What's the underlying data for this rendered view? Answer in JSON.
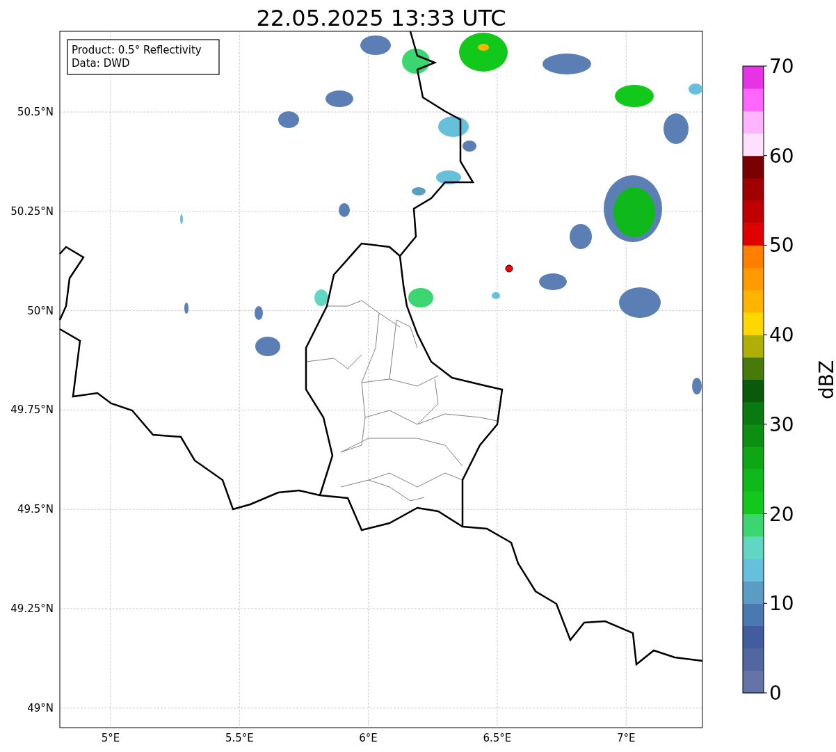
{
  "title": "22.05.2025 13:33 UTC",
  "info_box": {
    "lines": [
      "Product: 0.5° Reflectivity",
      "Data: DWD"
    ]
  },
  "map": {
    "lat_ticks": [
      "50.5°N",
      "50.25°N",
      "50°N",
      "49.75°N",
      "49.5°N",
      "49.25°N",
      "49°N"
    ],
    "lon_ticks": [
      "5°E",
      "5.5°E",
      "6°E",
      "6.5°E",
      "7°E"
    ]
  },
  "colorbar": {
    "label": "dBZ",
    "ticks": [
      "70",
      "60",
      "50",
      "40",
      "30",
      "20",
      "10",
      "0"
    ],
    "bins": [
      {
        "color": "#6574a6"
      },
      {
        "color": "#52679f"
      },
      {
        "color": "#415da0"
      },
      {
        "color": "#4a78b0"
      },
      {
        "color": "#5b9cc4"
      },
      {
        "color": "#66c0dc"
      },
      {
        "color": "#5fd7c3"
      },
      {
        "color": "#3cd670"
      },
      {
        "color": "#12c81a"
      },
      {
        "color": "#10b91b"
      },
      {
        "color": "#0ea615"
      },
      {
        "color": "#0c8e12"
      },
      {
        "color": "#0a7a10"
      },
      {
        "color": "#0a5a0c"
      },
      {
        "color": "#487a0a"
      },
      {
        "color": "#afaf08"
      },
      {
        "color": "#ffd700"
      },
      {
        "color": "#ffb400"
      },
      {
        "color": "#ff9a00"
      },
      {
        "color": "#ff7f00"
      },
      {
        "color": "#e00000"
      },
      {
        "color": "#c00000"
      },
      {
        "color": "#a00000"
      },
      {
        "color": "#780000"
      },
      {
        "color": "#ffe0ff"
      },
      {
        "color": "#ffb4ff"
      },
      {
        "color": "#ff66ff"
      },
      {
        "color": "#e633e6"
      }
    ]
  }
}
